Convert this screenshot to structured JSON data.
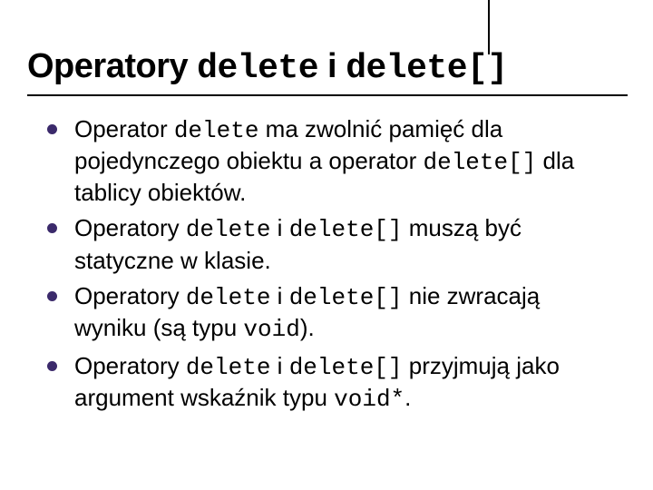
{
  "title": {
    "t1": "Operatory ",
    "c1": "delete",
    "t2": " i ",
    "c2": "delete[]"
  },
  "bullets": [
    {
      "p0": "Operator ",
      "c0": "delete",
      "p1": " ma zwolnić pamięć dla pojedynczego obiektu a operator ",
      "c1": "delete[]",
      "p2": " dla tablicy obiektów."
    },
    {
      "p0": "Operatory ",
      "c0": "delete",
      "p1": " i ",
      "c1": "delete[]",
      "p2": " muszą być statyczne w klasie."
    },
    {
      "p0": "Operatory ",
      "c0": "delete",
      "p1": " i ",
      "c1": "delete[]",
      "p2": " nie zwracają wyniku (są typu ",
      "c2": "void",
      "p3": ")."
    },
    {
      "p0": "Operatory ",
      "c0": "delete",
      "p1": " i ",
      "c1": "delete[]",
      "p2": " przyjmują jako argument wskaźnik typu ",
      "c2": "void*",
      "p3": "."
    }
  ]
}
